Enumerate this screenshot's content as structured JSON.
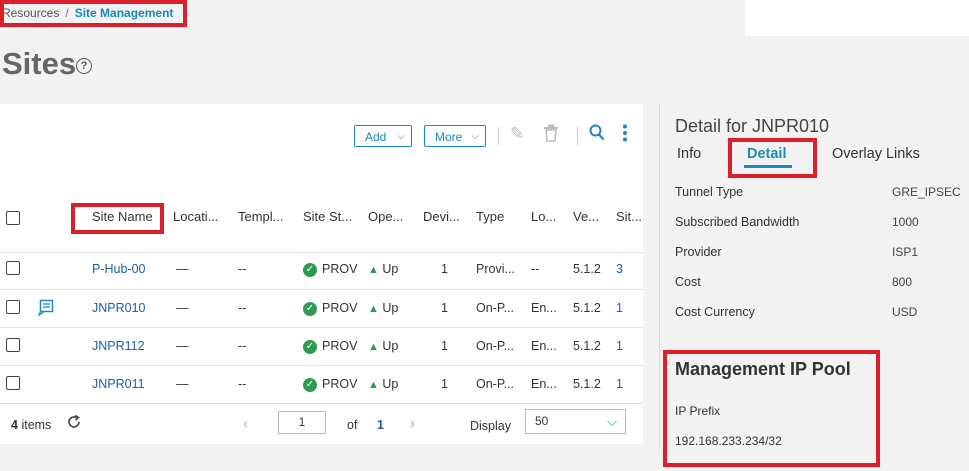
{
  "breadcrumb": {
    "parent": "Resources",
    "separator": "/",
    "current": "Site Management"
  },
  "page": {
    "title": "Sites",
    "help_glyph": "?"
  },
  "toolbar": {
    "add_label": "Add",
    "more_label": "More",
    "edit_icon": "pencil-icon",
    "delete_icon": "trash-icon",
    "search_icon": "search-icon",
    "kebab_icon": "kebab-icon"
  },
  "table": {
    "headers": [
      "Site Name",
      "Locati...",
      "Templ...",
      "Site St...",
      "Ope...",
      "Devi...",
      "Type",
      "Lo...",
      "Ve...",
      "Sit..."
    ],
    "rows": [
      {
        "name": "P-Hub-00",
        "location": "—",
        "template": "--",
        "status": "PROV",
        "oper": "Up",
        "devices": "1",
        "type": "Provi...",
        "loc2": "--",
        "version": "5.1.2",
        "sites": "3",
        "has_icon": false
      },
      {
        "name": "JNPR010",
        "location": "—",
        "template": "--",
        "status": "PROV",
        "oper": "Up",
        "devices": "1",
        "type": "On-P...",
        "loc2": "En...",
        "version": "5.1.2",
        "sites": "1",
        "has_icon": true
      },
      {
        "name": "JNPR112",
        "location": "—",
        "template": "--",
        "status": "PROV",
        "oper": "Up",
        "devices": "1",
        "type": "On-P...",
        "loc2": "En...",
        "version": "5.1.2",
        "sites": "1",
        "has_icon": false
      },
      {
        "name": "JNPR011",
        "location": "—",
        "template": "--",
        "status": "PROV",
        "oper": "Up",
        "devices": "1",
        "type": "On-P...",
        "loc2": "En...",
        "version": "5.1.2",
        "sites": "1",
        "has_icon": false
      }
    ]
  },
  "footer": {
    "count": "4",
    "items_label": "items",
    "page_value": "1",
    "of_label": "of",
    "total_pages": "1",
    "display_label": "Display",
    "page_size": "50"
  },
  "detail": {
    "title": "Detail for JNPR010",
    "tabs": [
      "Info",
      "Detail",
      "Overlay Links"
    ],
    "active_tab": "Detail",
    "fields": [
      {
        "key": "Tunnel Type",
        "value": "GRE_IPSEC"
      },
      {
        "key": "Subscribed Bandwidth",
        "value": "1000"
      },
      {
        "key": "Provider",
        "value": "ISP1"
      },
      {
        "key": "Cost",
        "value": "800"
      },
      {
        "key": "Cost Currency",
        "value": "USD"
      }
    ],
    "mgmt_pool_title": "Management IP Pool",
    "ip_prefix_label": "IP Prefix",
    "ip_prefix_value": "192.168.233.234/32"
  },
  "colors": {
    "accent": "#1a8ab8",
    "link": "#1a5fa8",
    "ok": "#2e9a52",
    "highlight": "#d9202b"
  }
}
